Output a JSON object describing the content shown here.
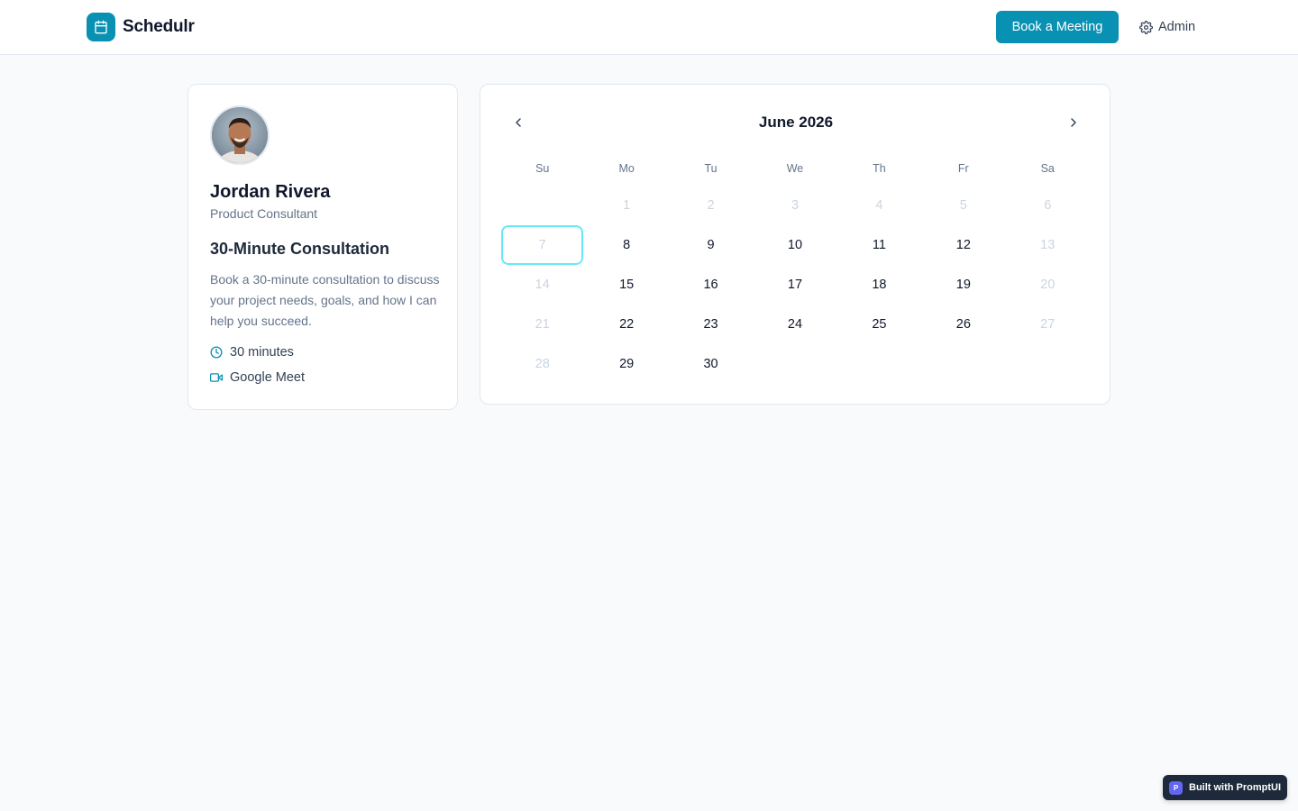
{
  "app": {
    "brand_name": "Schedulr",
    "brand_icon": "calendar-icon",
    "accent_color": "#0891b2"
  },
  "header": {
    "book_label": "Book a Meeting",
    "admin_label": "Admin"
  },
  "profile": {
    "name": "Jordan Rivera",
    "role": "Product Consultant",
    "event_title": "30-Minute Consultation",
    "description": "Book a 30-minute consultation to discuss your project needs, goals, and how I can help you succeed.",
    "duration": "30 minutes",
    "location": "Google Meet"
  },
  "calendar": {
    "month_label": "June 2026",
    "weekdays": [
      "Su",
      "Mo",
      "Tu",
      "We",
      "Th",
      "Fr",
      "Sa"
    ],
    "leading_blanks": 1,
    "days": [
      {
        "label": "1",
        "state": "unavailable"
      },
      {
        "label": "2",
        "state": "unavailable"
      },
      {
        "label": "3",
        "state": "unavailable"
      },
      {
        "label": "4",
        "state": "unavailable"
      },
      {
        "label": "5",
        "state": "unavailable"
      },
      {
        "label": "6",
        "state": "unavailable"
      },
      {
        "label": "7",
        "state": "today"
      },
      {
        "label": "8",
        "state": "available"
      },
      {
        "label": "9",
        "state": "available"
      },
      {
        "label": "10",
        "state": "available"
      },
      {
        "label": "11",
        "state": "available"
      },
      {
        "label": "12",
        "state": "available"
      },
      {
        "label": "13",
        "state": "unavailable"
      },
      {
        "label": "14",
        "state": "unavailable"
      },
      {
        "label": "15",
        "state": "available"
      },
      {
        "label": "16",
        "state": "available"
      },
      {
        "label": "17",
        "state": "available"
      },
      {
        "label": "18",
        "state": "available"
      },
      {
        "label": "19",
        "state": "available"
      },
      {
        "label": "20",
        "state": "unavailable"
      },
      {
        "label": "21",
        "state": "unavailable"
      },
      {
        "label": "22",
        "state": "available"
      },
      {
        "label": "23",
        "state": "available"
      },
      {
        "label": "24",
        "state": "available"
      },
      {
        "label": "25",
        "state": "available"
      },
      {
        "label": "26",
        "state": "available"
      },
      {
        "label": "27",
        "state": "unavailable"
      },
      {
        "label": "28",
        "state": "unavailable"
      },
      {
        "label": "29",
        "state": "available"
      },
      {
        "label": "30",
        "state": "available"
      }
    ]
  },
  "badge": {
    "logo_letter": "P",
    "label": "Built with PromptUI"
  }
}
